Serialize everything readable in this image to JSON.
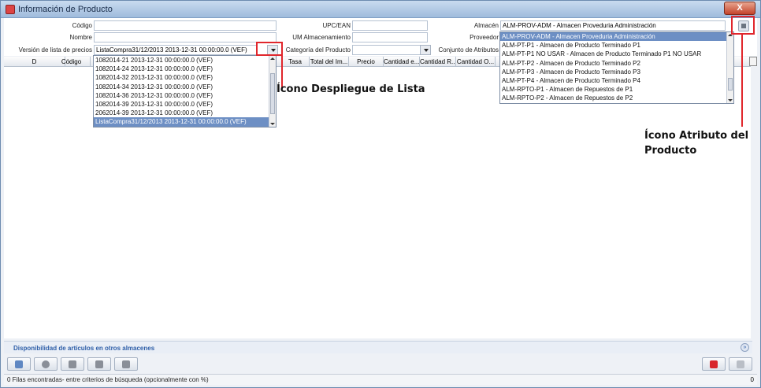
{
  "window": {
    "title": "Información de Producto",
    "close_label": "X"
  },
  "form": {
    "codigo_label": "Código",
    "nombre_label": "Nombre",
    "version_label": "Versión de lista de precios",
    "version_value": "ListaCompra31/12/2013 2013-12-31 00:00:00.0 (VEF)",
    "upc_label": "UPC/EAN",
    "um_label": "UM Almacenamiento",
    "categoria_label": "Categoría del Producto",
    "almacen_label": "Almacén",
    "almacen_value": "ALM-PROV-ADM - Almacen Proveduria Administración",
    "proveedor_label": "Proveedor",
    "conjunto_label": "Conjunto de Atributos"
  },
  "grid": {
    "columns": [
      "D",
      "Código",
      "Tasa",
      "Total del Im...",
      "Precio",
      "Cantidad e...",
      "Cantidad R...",
      "Cantidad O..."
    ]
  },
  "version_list": {
    "options": [
      "1082014-21 2013-12-31 00:00:00.0 (VEF)",
      "1082014-24 2013-12-31 00:00:00.0 (VEF)",
      "1082014-32 2013-12-31 00:00:00.0 (VEF)",
      "1082014-34 2013-12-31 00:00:00.0 (VEF)",
      "1082014-36 2013-12-31 00:00:00.0 (VEF)",
      "1082014-39 2013-12-31 00:00:00.0 (VEF)",
      "2062014-39 2013-12-31 00:00:00.0 (VEF)",
      "ListaCompra31/12/2013 2013-12-31 00:00:00.0 (VEF)"
    ],
    "selected_index": 7
  },
  "almacen_list": {
    "options": [
      "ALM-PROV-ADM - Almacen Proveduria Administración",
      "ALM-PT-P1 - Almacen de Producto Terminado P1",
      "ALM-PT-P1 NO USAR - Almacen de Producto Terminado P1 NO USAR",
      "ALM-PT-P2 - Almacen de Producto Terminado P2",
      "ALM-PT-P3 - Almacen de Producto Terminado P3",
      "ALM-PT-P4 - Almacen de Producto Terminado P4",
      "ALM-RPTO-P1 - Almacen de Repuestos de P1",
      "ALM-RPTO-P2 - Almacen de Repuestos de P2"
    ],
    "selected_index": 0
  },
  "annotations": {
    "dropdown_note": "Ícono Despliegue de Lista",
    "attribute_note_line1": "Ícono Atributo del",
    "attribute_note_line2": "Producto"
  },
  "availability": {
    "label": "Disponibilidad de artículos en otros almacenes"
  },
  "status": {
    "text": "0 Filas encontradas- entre criterios de búsqueda (opcionalmente con %)",
    "count": "0"
  },
  "colors": {
    "annotation_red": "#e0262c",
    "selection_blue": "#6d8fc4",
    "accent_text": "#2f5fa8"
  },
  "icons": {
    "toolbar": [
      "refresh-icon",
      "history-icon",
      "zoom-icon",
      "print-icon",
      "attribute-icon"
    ],
    "actions": [
      "cancel-icon",
      "ok-icon"
    ]
  }
}
